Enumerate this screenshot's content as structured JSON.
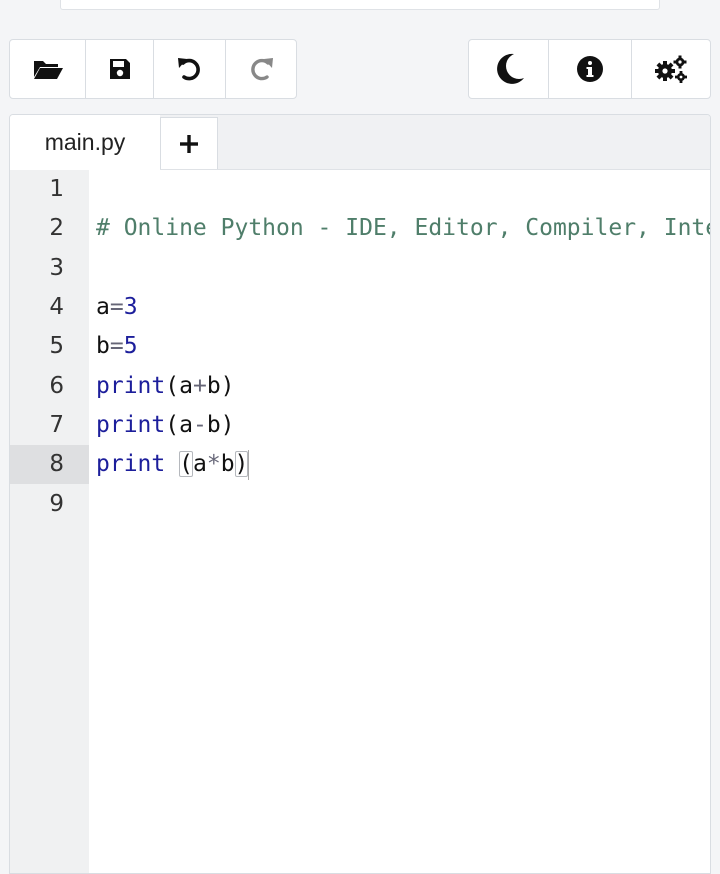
{
  "toolbar": {
    "left": [
      {
        "name": "open-folder-button",
        "icon": "folder-open-icon"
      },
      {
        "name": "save-button",
        "icon": "floppy-disk-icon"
      },
      {
        "name": "undo-button",
        "icon": "undo-icon"
      },
      {
        "name": "redo-button",
        "icon": "redo-icon"
      }
    ],
    "right": [
      {
        "name": "dark-mode-button",
        "icon": "moon-icon"
      },
      {
        "name": "info-button",
        "icon": "info-circle-icon"
      },
      {
        "name": "settings-button",
        "icon": "gears-icon"
      }
    ]
  },
  "tabs": {
    "active_label": "main.py",
    "add_label": "+"
  },
  "editor": {
    "line_numbers": [
      "1",
      "2",
      "3",
      "4",
      "5",
      "6",
      "7",
      "8",
      "9"
    ],
    "active_line": "8",
    "lines": {
      "l2": "# Online Python - IDE, Editor, Compiler, Interpreter",
      "l4_var": "a",
      "l4_op": "=",
      "l4_val": "3",
      "l5_var": "b",
      "l5_op": "=",
      "l5_val": "5",
      "l6_kw": "print",
      "l6_rest_a": "(a",
      "l6_op": "+",
      "l6_rest_b": "b)",
      "l7_kw": "print",
      "l7_rest_a": "(a",
      "l7_op": "-",
      "l7_rest_b": "b)",
      "l8_kw": "print",
      "l8_space": " ",
      "l8_open": "(",
      "l8_a": "a",
      "l8_op": "*",
      "l8_b": "b",
      "l8_close": ")"
    }
  },
  "colors": {
    "comment": "#4f7e6a",
    "keyword": "#1c1e9b",
    "number": "#1c1e9b",
    "gutter_bg": "#f0f1f2",
    "active_line_bg": "#dedfe1"
  }
}
